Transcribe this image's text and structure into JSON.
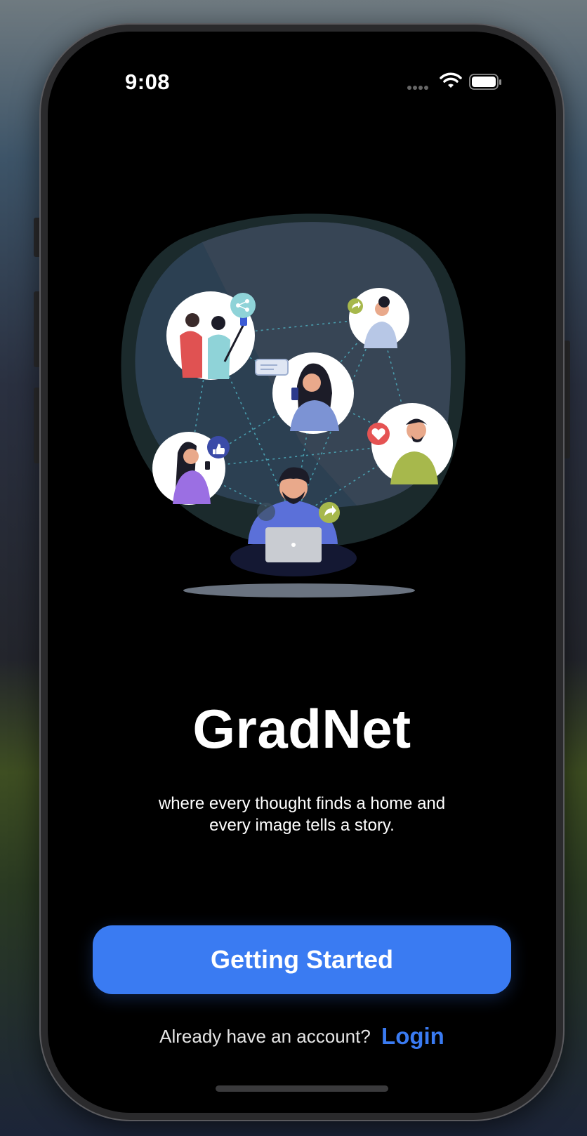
{
  "status_bar": {
    "time": "9:08"
  },
  "app": {
    "title": "GradNet",
    "tagline_line1": "where every thought finds a home and",
    "tagline_line2": "every image tells a story."
  },
  "actions": {
    "getting_started_label": "Getting Started",
    "login_prompt": "Already have an account?",
    "login_label": "Login"
  },
  "colors": {
    "accent": "#3a7bf2",
    "background": "#000000"
  },
  "icons": [
    "wifi-icon",
    "battery-icon",
    "share-icon",
    "forward-icon",
    "like-icon",
    "heart-icon",
    "laptop-icon"
  ]
}
